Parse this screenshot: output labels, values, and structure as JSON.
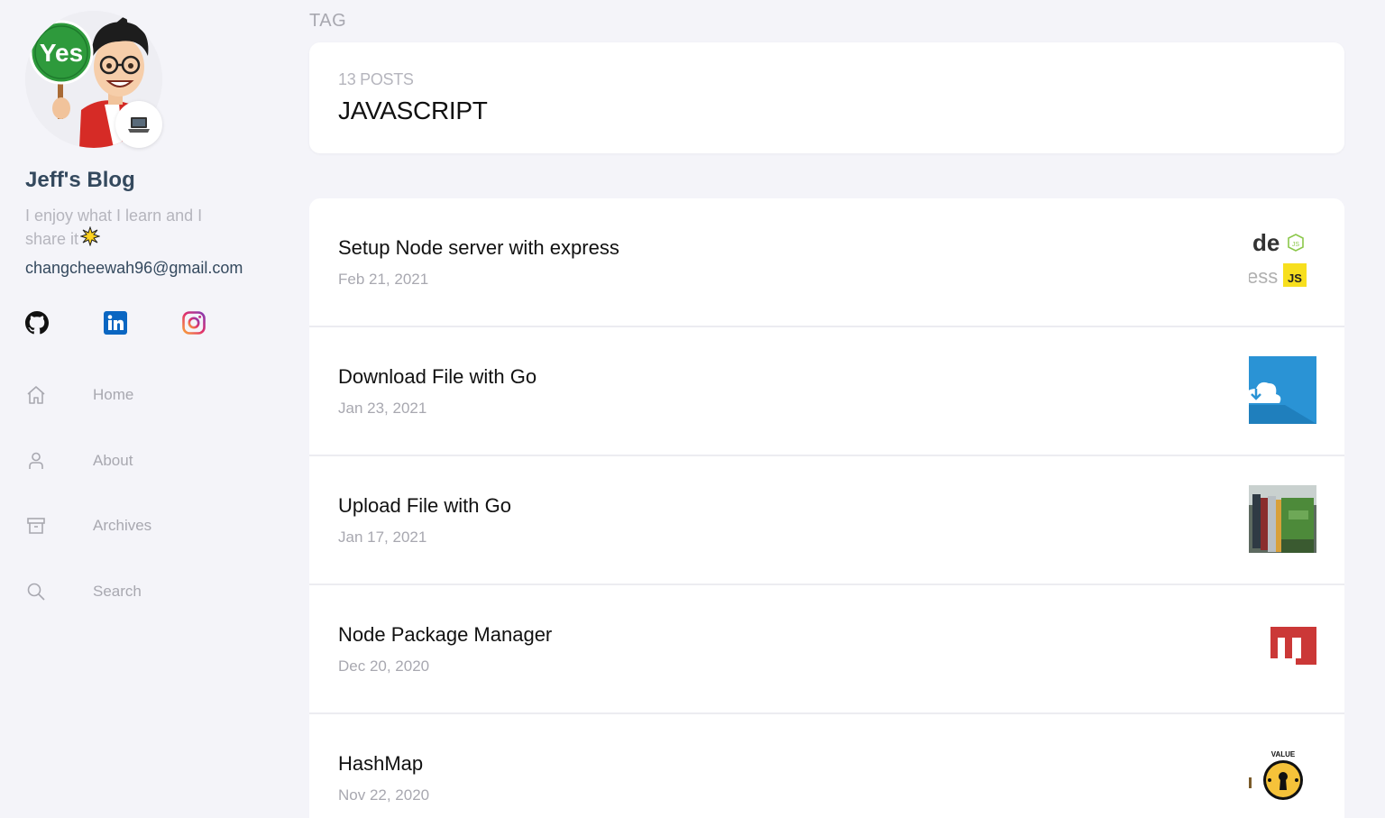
{
  "sidebar": {
    "blog_title": "Jeff's Blog",
    "tagline": "I enjoy what I learn and I share it",
    "email": "changcheewah96@gmail.com",
    "avatar_sign_text": "Yes",
    "socials": [
      {
        "name": "github",
        "icon": "github-icon"
      },
      {
        "name": "linkedin",
        "icon": "linkedin-icon",
        "color": "#0a66c2"
      },
      {
        "name": "instagram",
        "icon": "instagram-icon"
      }
    ],
    "nav": [
      {
        "label": "Home",
        "icon": "home-icon"
      },
      {
        "label": "About",
        "icon": "user-icon"
      },
      {
        "label": "Archives",
        "icon": "archive-icon"
      },
      {
        "label": "Search",
        "icon": "search-icon"
      }
    ]
  },
  "main": {
    "page_type": "TAG",
    "tag": {
      "count": "13 POSTS",
      "name": "JAVASCRIPT"
    },
    "posts": [
      {
        "title": "Setup Node server with express",
        "date": "Feb 21, 2021",
        "thumb": "node-express-thumbnail",
        "thumb_text_1": "de",
        "thumb_text_2": "ess",
        "thumb_badge": "JS"
      },
      {
        "title": "Download File with Go",
        "date": "Jan 23, 2021",
        "thumb": "cloud-download-thumbnail"
      },
      {
        "title": "Upload File with Go",
        "date": "Jan 17, 2021",
        "thumb": "files-photo-thumbnail"
      },
      {
        "title": "Node Package Manager",
        "date": "Dec 20, 2020",
        "thumb": "npm-logo-thumbnail"
      },
      {
        "title": "HashMap",
        "date": "Nov 22, 2020",
        "thumb": "key-value-thumbnail",
        "thumb_text_1": "VALUE"
      }
    ]
  },
  "colors": {
    "background": "#f4f4f9",
    "card": "#ffffff",
    "heading": "#34495e",
    "muted": "#a8a8b0",
    "linkedin": "#0a66c2",
    "npm_red": "#cb3837",
    "js_yellow": "#f7df1e"
  }
}
